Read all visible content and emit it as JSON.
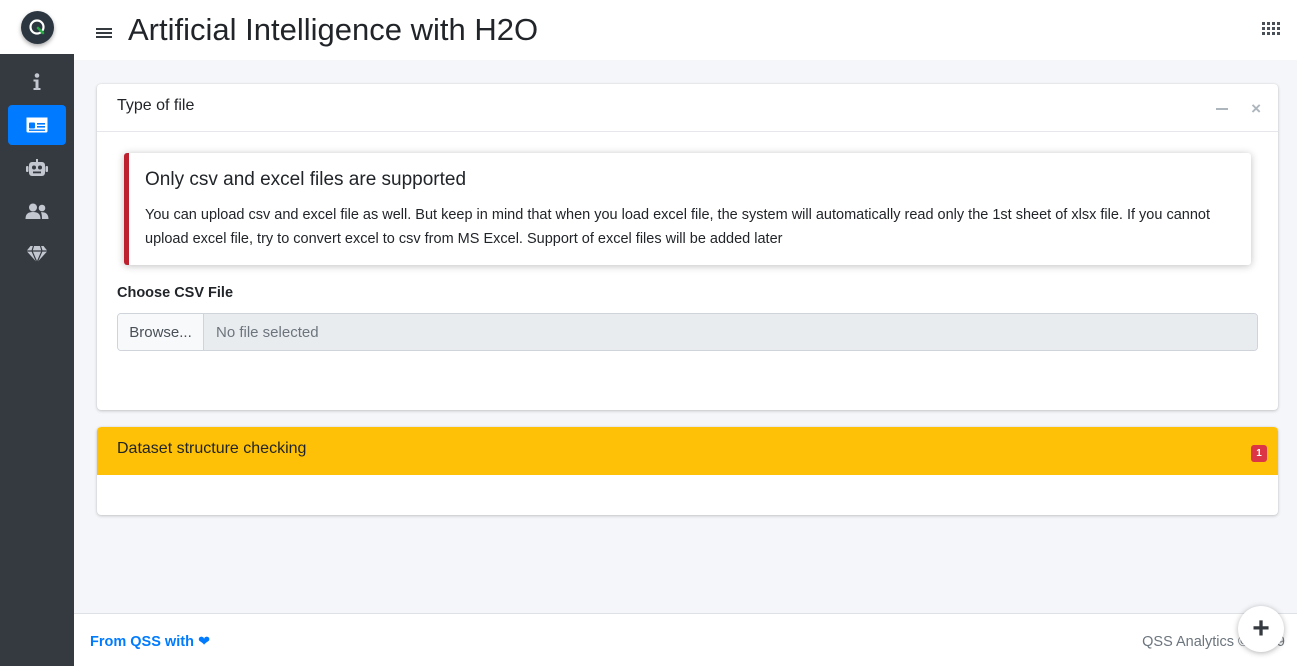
{
  "app": {
    "title": "Artificial Intelligence with H2O"
  },
  "sidebar": {
    "items": [
      {
        "icon": "info-icon",
        "active": false
      },
      {
        "icon": "id-card-icon",
        "active": true
      },
      {
        "icon": "robot-icon",
        "active": false
      },
      {
        "icon": "users-icon",
        "active": false
      },
      {
        "icon": "gem-icon",
        "active": false
      }
    ]
  },
  "card_file": {
    "title": "Type of file",
    "callout": {
      "title": "Only csv and excel files are supported",
      "text": "You can upload csv and excel file as well. But keep in mind that when you load excel file, the system will automatically read only the 1st sheet of xlsx file. If you cannot upload excel file, try to convert excel to csv from MS Excel. Support of excel files will be added later"
    },
    "file_label": "Choose CSV File",
    "browse_label": "Browse...",
    "file_placeholder": "No file selected"
  },
  "card_dataset": {
    "title": "Dataset structure checking",
    "badge": "1"
  },
  "footer": {
    "left_text": "From QSS with",
    "heart": "❤",
    "right_text": "QSS Analytics © 2019"
  },
  "fab": {
    "label": "+"
  },
  "colors": {
    "accent": "#007bff",
    "sidebar": "#343a40",
    "warning": "#ffc107",
    "danger": "#dc3545",
    "callout_border": "#bd2130"
  }
}
